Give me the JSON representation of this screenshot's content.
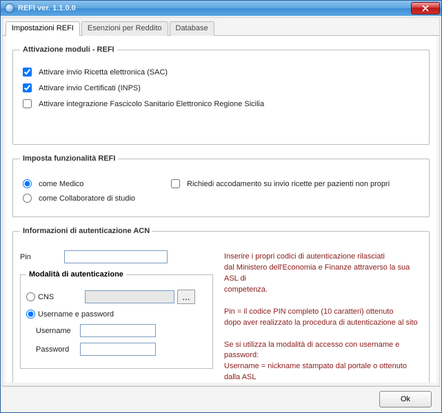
{
  "window": {
    "title": "REFI ver. 1.1.0.0"
  },
  "tabs": [
    {
      "label": "Impostazioni REFI"
    },
    {
      "label": "Esenzioni per Reddito"
    },
    {
      "label": "Database"
    }
  ],
  "group_activation": {
    "legend": "Attivazione moduli - REFI",
    "items": [
      {
        "label": "Attivare invio Ricetta elettronica (SAC)",
        "checked": true
      },
      {
        "label": "Attivare invio Certificati (INPS)",
        "checked": true
      },
      {
        "label": "Attivare integrazione Fascicolo Sanitario Elettronico Regione Sicilia",
        "checked": false
      }
    ]
  },
  "group_func": {
    "legend": "Imposta funzionalità REFI",
    "role_medico": "come Medico",
    "role_collab": "come Collaboratore di studio",
    "queue_label": "Richiedi accodamento su invio ricette per pazienti non propri"
  },
  "group_auth": {
    "legend": "Informazioni di autenticazione  ACN",
    "pin_label": "Pin",
    "pin_value": "",
    "mode_legend": "Modalità di autenticazione",
    "mode_cns": "CNS",
    "mode_userpass": "Username e password",
    "username_label": "Username",
    "username_value": "",
    "password_label": "Password",
    "password_value": "",
    "browse_label": "...",
    "help": {
      "p1": "Inserire i propri codici di autenticazione rilasciati\ndal Ministero dell'Economia e Finanze attraverso la sua ASL di\ncompetenza.",
      "p2": "Pin = il codice PIN completo (10 caratteri) ottenuto\ndopo aver realizzato la procedura di autenticazione al sito",
      "p3": "Se si utilizza la modalità di accesso con username e password:\nUsername = nickname stampato dal portale o ottenuto dalla ASL\nPassword = la password di accesso al sito"
    }
  },
  "buttons": {
    "ok": "Ok"
  }
}
